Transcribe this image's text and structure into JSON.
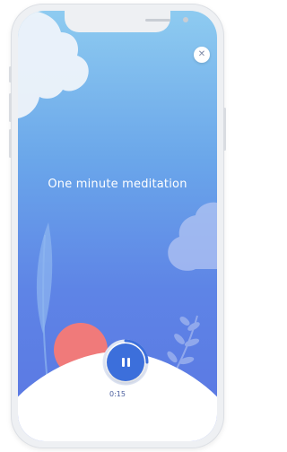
{
  "session": {
    "title": "One minute meditation",
    "elapsed": "0:15",
    "progress_fraction": 0.25
  },
  "controls": {
    "close_icon": "close-icon",
    "pause_icon": "pause-icon"
  },
  "colors": {
    "gradient_top": "#8ecbf0",
    "gradient_bottom": "#5a76e2",
    "accent": "#3c6fdb",
    "sun": "#f07a7a"
  }
}
